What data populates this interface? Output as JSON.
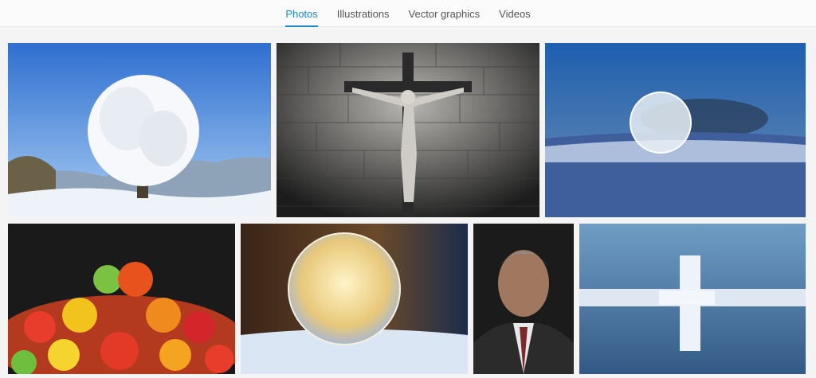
{
  "tabs": [
    {
      "label": "Photos",
      "active": true
    },
    {
      "label": "Illustrations",
      "active": false
    },
    {
      "label": "Vector graphics",
      "active": false
    },
    {
      "label": "Videos",
      "active": false
    }
  ],
  "accent_color": "#1a88c9",
  "gallery": [
    {
      "subject": "frosted-tree-winter"
    },
    {
      "subject": "crucifix-stone-wall"
    },
    {
      "subject": "frozen-bubble-snow"
    },
    {
      "subject": "gummy-bears"
    },
    {
      "subject": "frozen-bubble-closeup"
    },
    {
      "subject": "man-portrait"
    },
    {
      "subject": "frosted-barbed-wire"
    }
  ]
}
